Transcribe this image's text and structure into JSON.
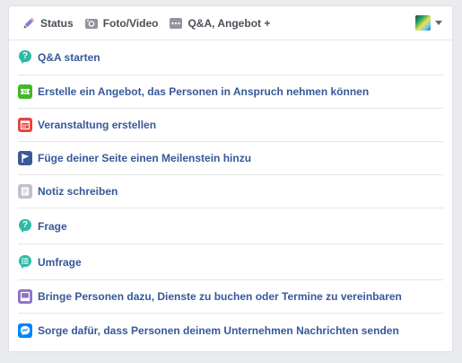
{
  "composer": {
    "tabs": [
      {
        "label": "Status",
        "icon": "pencil-icon"
      },
      {
        "label": "Foto/Video",
        "icon": "camera-icon"
      },
      {
        "label": "Q&A, Angebot +",
        "icon": "more-icon"
      }
    ],
    "menu": [
      {
        "label": "Q&A starten",
        "icon": "qa-icon",
        "color": "#2abba7"
      },
      {
        "label": "Erstelle ein Angebot, das Personen in Anspruch nehmen können",
        "icon": "offer-ticket-icon",
        "color": "#42b72a"
      },
      {
        "label": "Veranstaltung erstellen",
        "icon": "calendar-icon",
        "color": "#e9403c"
      },
      {
        "label": "Füge deiner Seite einen Meilenstein hinzu",
        "icon": "milestone-flag-icon",
        "color": "#3b5998"
      },
      {
        "label": "Notiz schreiben",
        "icon": "note-icon",
        "color": "#bec3c9"
      },
      {
        "label": "Frage",
        "icon": "question-icon",
        "color": "#2abba7"
      },
      {
        "label": "Umfrage",
        "icon": "poll-icon",
        "color": "#2abba7"
      },
      {
        "label": "Bringe Personen dazu, Dienste zu buchen oder Termine zu vereinbaren",
        "icon": "booking-icon",
        "color": "#8c72cb"
      },
      {
        "label": "Sorge dafür, dass Personen deinem Unternehmen Nachrichten senden",
        "icon": "messenger-icon",
        "color": "#0084ff"
      }
    ]
  }
}
